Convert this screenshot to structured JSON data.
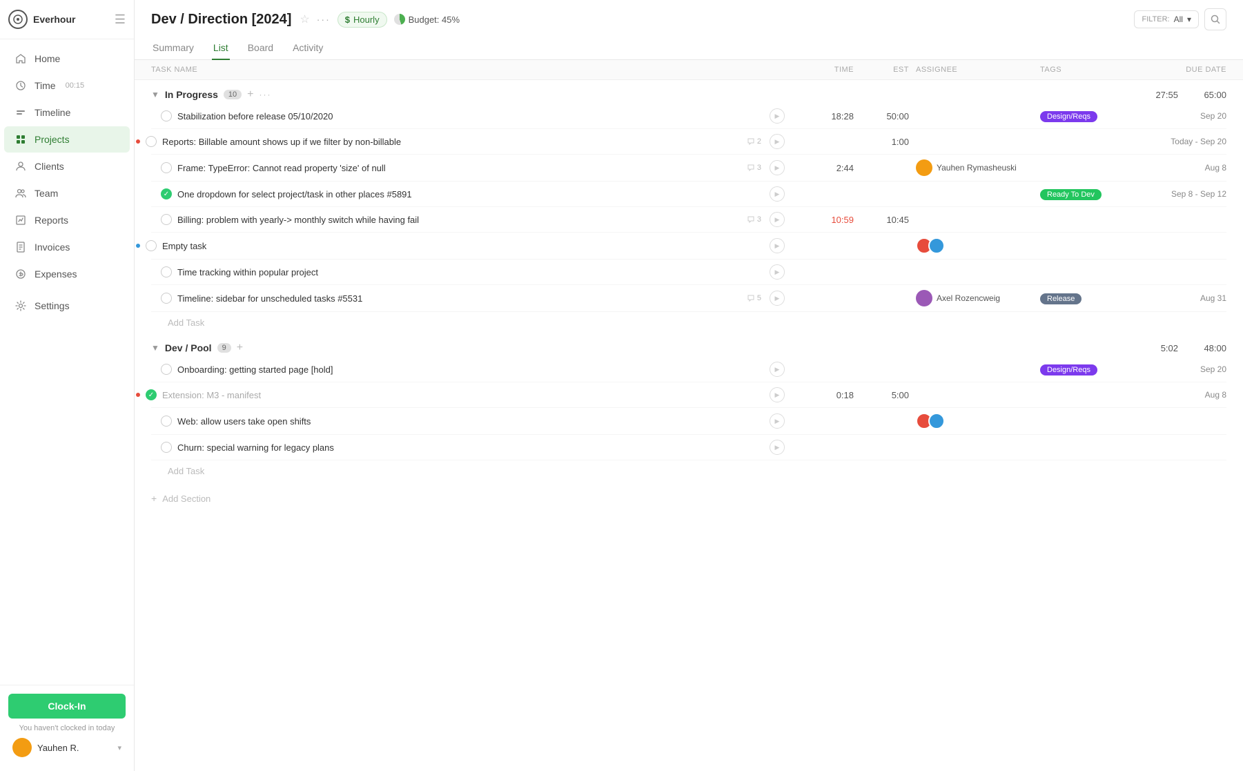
{
  "app": {
    "name": "Everhour"
  },
  "sidebar": {
    "nav_items": [
      {
        "id": "home",
        "label": "Home",
        "icon": "home"
      },
      {
        "id": "time",
        "label": "Time",
        "badge": "00:15",
        "icon": "clock"
      },
      {
        "id": "timeline",
        "label": "Timeline",
        "icon": "timeline"
      },
      {
        "id": "projects",
        "label": "Projects",
        "icon": "projects",
        "active": true
      },
      {
        "id": "clients",
        "label": "Clients",
        "icon": "clients"
      },
      {
        "id": "team",
        "label": "Team",
        "icon": "team"
      },
      {
        "id": "reports",
        "label": "Reports",
        "icon": "reports"
      },
      {
        "id": "invoices",
        "label": "Invoices",
        "icon": "invoices"
      },
      {
        "id": "expenses",
        "label": "Expenses",
        "icon": "expenses"
      },
      {
        "id": "settings",
        "label": "Settings",
        "icon": "settings"
      }
    ],
    "clockin_button": "Clock-In",
    "clockin_message": "You haven't clocked in today",
    "user_name": "Yauhen R."
  },
  "header": {
    "project_title": "Dev / Direction [2024]",
    "hourly_label": "Hourly",
    "budget_label": "Budget: 45%",
    "budget_pct": 45,
    "filter_label": "FILTER:",
    "filter_value": "All",
    "tabs": [
      "Summary",
      "List",
      "Board",
      "Activity"
    ],
    "active_tab": "List"
  },
  "table": {
    "columns": [
      "TASK NAME",
      "TIME",
      "EST",
      "ASSIGNEE",
      "TAGS",
      "DUE DATE"
    ]
  },
  "sections": [
    {
      "id": "in-progress",
      "title": "In Progress",
      "count": 10,
      "total_time": "27:55",
      "total_est": "65:00",
      "tasks": [
        {
          "id": 1,
          "name": "Stabilization before release 05/10/2020",
          "done": false,
          "dot": null,
          "comments": null,
          "time": "18:28",
          "est": "50:00",
          "assignee": null,
          "assignees": [],
          "tag": "Design/Reqs",
          "tag_class": "tag-design",
          "due": "Sep 20"
        },
        {
          "id": 2,
          "name": "Reports: Billable amount shows up if we filter by non-billable",
          "done": false,
          "dot": "red",
          "comments": 2,
          "time": null,
          "est": "1:00",
          "assignee": null,
          "assignees": [],
          "tag": null,
          "due": "Today - Sep 20"
        },
        {
          "id": 3,
          "name": "Frame: TypeError: Cannot read property 'size' of null",
          "done": false,
          "dot": null,
          "comments": 3,
          "time": "2:44",
          "est": null,
          "assignee": "Yauhen Rymasheuski",
          "assignees": [
            "yauhen"
          ],
          "tag": null,
          "due": "Aug 8"
        },
        {
          "id": 4,
          "name": "One dropdown for select project/task in other places #5891",
          "done": true,
          "dot": null,
          "comments": null,
          "time": null,
          "est": null,
          "assignee": null,
          "assignees": [],
          "tag": "Ready To Dev",
          "tag_class": "tag-ready",
          "due": "Sep 8 - Sep 12"
        },
        {
          "id": 5,
          "name": "Billing: problem with yearly-> monthly switch while having fail",
          "done": false,
          "dot": null,
          "comments": 3,
          "time": "10:59",
          "time_red": true,
          "est": "10:45",
          "assignee": null,
          "assignees": [],
          "tag": null,
          "due": null
        },
        {
          "id": 6,
          "name": "Empty task",
          "done": false,
          "dot": "blue",
          "comments": null,
          "time": null,
          "est": null,
          "assignee": null,
          "assignees": [
            "user1",
            "user2"
          ],
          "tag": null,
          "due": null
        },
        {
          "id": 7,
          "name": "Time tracking within popular project",
          "done": false,
          "dot": null,
          "comments": null,
          "time": null,
          "est": null,
          "assignee": null,
          "assignees": [],
          "tag": null,
          "due": null
        },
        {
          "id": 8,
          "name": "Timeline: sidebar for unscheduled tasks #5531",
          "done": false,
          "dot": null,
          "comments": 5,
          "time": null,
          "est": null,
          "assignee": "Axel Rozencweig",
          "assignees": [
            "axel"
          ],
          "tag": "Release",
          "tag_class": "tag-release",
          "due": "Aug 31"
        }
      ],
      "add_task_label": "Add Task"
    },
    {
      "id": "dev-pool",
      "title": "Dev / Pool",
      "count": 9,
      "total_time": "5:02",
      "total_est": "48:00",
      "tasks": [
        {
          "id": 9,
          "name": "Onboarding: getting started page [hold]",
          "done": false,
          "dot": null,
          "comments": null,
          "time": null,
          "est": null,
          "assignee": null,
          "assignees": [],
          "tag": "Design/Reqs",
          "tag_class": "tag-design",
          "due": "Sep 20"
        },
        {
          "id": 10,
          "name": "Extension: M3 - manifest",
          "done": true,
          "dot": "red",
          "comments": null,
          "time": "0:18",
          "est": "5:00",
          "assignee": null,
          "assignees": [],
          "tag": null,
          "due": "Aug 8",
          "muted": true
        },
        {
          "id": 11,
          "name": "Web: allow users take open shifts",
          "done": false,
          "dot": null,
          "comments": null,
          "time": null,
          "est": null,
          "assignee": null,
          "assignees": [
            "user1",
            "user2"
          ],
          "tag": null,
          "due": null
        },
        {
          "id": 12,
          "name": "Churn: special warning for legacy plans",
          "done": false,
          "dot": null,
          "comments": null,
          "time": null,
          "est": null,
          "assignee": null,
          "assignees": [],
          "tag": null,
          "due": null
        }
      ],
      "add_task_label": "Add Task"
    }
  ],
  "add_section_label": "Add Section"
}
